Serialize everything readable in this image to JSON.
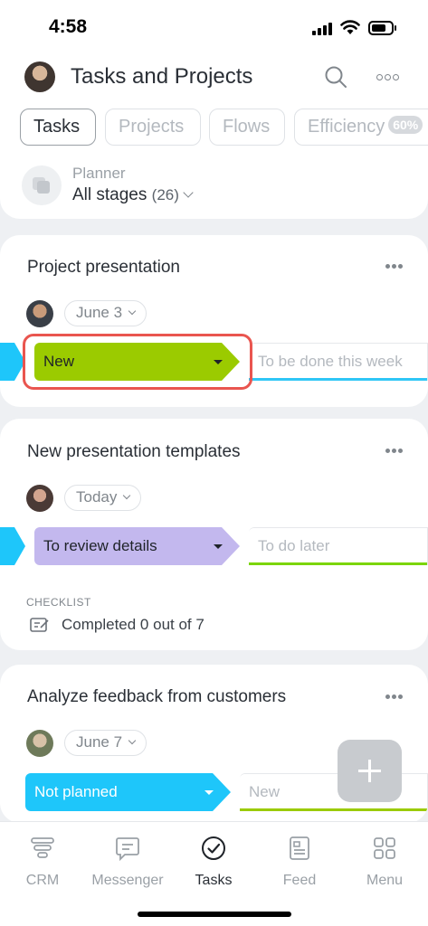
{
  "status_bar": {
    "time": "4:58"
  },
  "header": {
    "title": "Tasks and Projects",
    "tabs": [
      {
        "label": "Tasks",
        "active": true
      },
      {
        "label": "Projects"
      },
      {
        "label": "Flows"
      },
      {
        "label": "Efficiency",
        "badge": "60%"
      }
    ],
    "planner": {
      "label": "Planner",
      "stage": "All stages",
      "count": "(26)"
    }
  },
  "tasks": [
    {
      "title": "Project presentation",
      "date": "June 3",
      "stage": "New",
      "stage_color": "#9bcb00",
      "next_stage": "To be done this week",
      "next_bar_color": "#2fc6f6"
    },
    {
      "title": "New presentation templates",
      "date": "Today",
      "stage": "To review details",
      "stage_color": "#c3b8ee",
      "next_stage": "To do later",
      "next_bar_color": "#7bd500",
      "checklist_label": "CHECKLIST",
      "checklist_text": "Completed 0 out of 7"
    },
    {
      "title": "Analyze feedback from customers",
      "date": "June 7",
      "stage": "Not planned",
      "stage_color": "#1ec6fa",
      "next_stage": "New",
      "next_bar_color": "#9bcb00"
    }
  ],
  "nav": [
    {
      "label": "CRM",
      "icon": "crm-icon"
    },
    {
      "label": "Messenger",
      "icon": "chat-icon"
    },
    {
      "label": "Tasks",
      "icon": "check-circle-icon",
      "active": true
    },
    {
      "label": "Feed",
      "icon": "feed-icon"
    },
    {
      "label": "Menu",
      "icon": "grid-icon"
    }
  ]
}
